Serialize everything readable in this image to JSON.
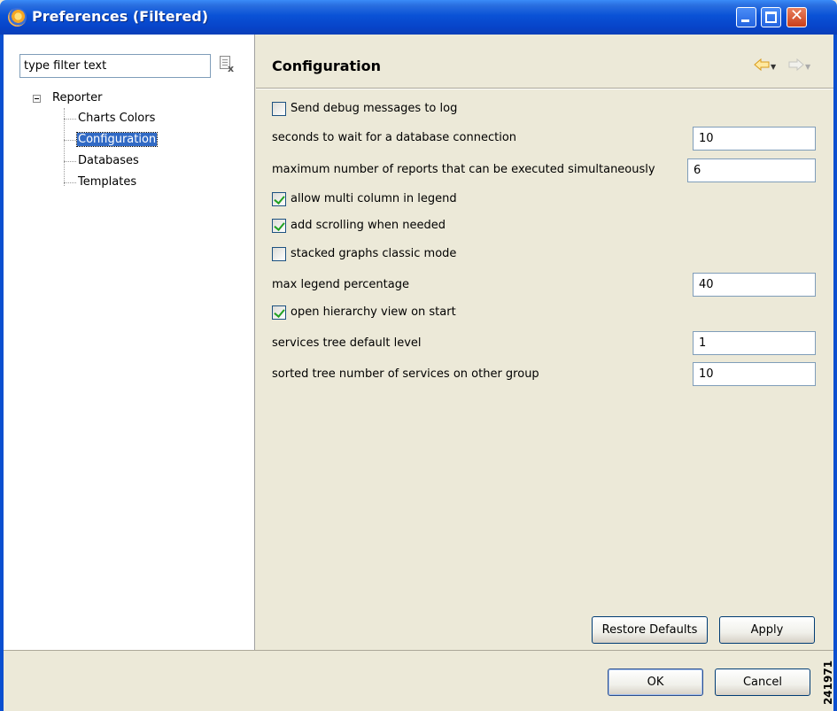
{
  "window": {
    "title": "Preferences (Filtered)",
    "buttons": {
      "minimize": "minimize-icon",
      "maximize": "maximize-icon",
      "close": "close-icon"
    }
  },
  "filter": {
    "value": "type filter text",
    "clear_icon": "clear-filter-icon"
  },
  "tree": {
    "root": "Reporter",
    "items": [
      {
        "label": "Charts Colors",
        "selected": false
      },
      {
        "label": "Configuration",
        "selected": true
      },
      {
        "label": "Databases",
        "selected": false
      },
      {
        "label": "Templates",
        "selected": false
      }
    ]
  },
  "page": {
    "title": "Configuration",
    "nav": {
      "back_icon": "back-arrow-icon",
      "forward_icon": "forward-arrow-icon"
    }
  },
  "settings": {
    "debug": {
      "label": "Send debug messages to log",
      "checked": false
    },
    "db_wait": {
      "label": "seconds to wait for a database connection",
      "value": "10"
    },
    "max_reports": {
      "label": "maximum number of reports that can be executed simultaneously",
      "value": "6"
    },
    "multi_column": {
      "label": "allow multi column in legend",
      "checked": true
    },
    "scrolling": {
      "label": "add scrolling when needed",
      "checked": true
    },
    "stacked": {
      "label": "stacked graphs classic mode",
      "checked": false
    },
    "legend_pct": {
      "label": "max legend percentage",
      "value": "40"
    },
    "hierarchy": {
      "label": "open hierarchy view on start",
      "checked": true
    },
    "tree_level": {
      "label": "services tree default level",
      "value": "1"
    },
    "other_group": {
      "label": "sorted tree number of services on other group",
      "value": "10"
    }
  },
  "buttons": {
    "restore": "Restore Defaults",
    "apply": "Apply",
    "ok": "OK",
    "cancel": "Cancel"
  },
  "side_tag": "241971"
}
